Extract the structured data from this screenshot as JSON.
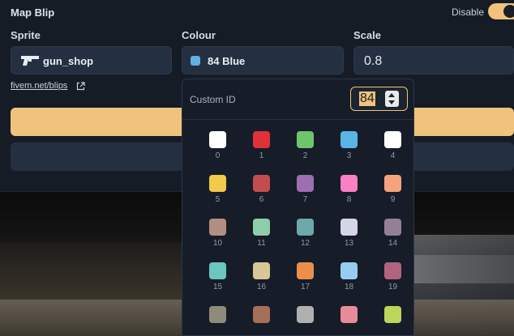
{
  "header": {
    "title": "Map Blip",
    "disable_label": "Disable",
    "disable_on": true
  },
  "fields": {
    "sprite": {
      "label": "Sprite",
      "value": "gun_shop",
      "icon": "pistol-icon"
    },
    "colour": {
      "label": "Colour",
      "value": "84 Blue",
      "swatch": "#5fb2e4"
    },
    "scale": {
      "label": "Scale",
      "value": "0.8"
    }
  },
  "link": {
    "text": "fivem.net/blips",
    "icon": "external-link-icon"
  },
  "dropdown": {
    "custom_id_label": "Custom ID",
    "custom_id_value": "84",
    "colors": [
      {
        "id": "0",
        "hex": "#ffffff"
      },
      {
        "id": "1",
        "hex": "#e0313a"
      },
      {
        "id": "2",
        "hex": "#6dc56e"
      },
      {
        "id": "3",
        "hex": "#5ab4e5"
      },
      {
        "id": "4",
        "hex": "#ffffff"
      },
      {
        "id": "5",
        "hex": "#f2c94c"
      },
      {
        "id": "6",
        "hex": "#c24d4f"
      },
      {
        "id": "7",
        "hex": "#9d6eb2"
      },
      {
        "id": "8",
        "hex": "#fb7fc3"
      },
      {
        "id": "9",
        "hex": "#f5a37c"
      },
      {
        "id": "10",
        "hex": "#b18f82"
      },
      {
        "id": "11",
        "hex": "#8fceaa"
      },
      {
        "id": "12",
        "hex": "#6ea8ad"
      },
      {
        "id": "13",
        "hex": "#d5d4e8"
      },
      {
        "id": "14",
        "hex": "#938097"
      },
      {
        "id": "15",
        "hex": "#69c6c1"
      },
      {
        "id": "16",
        "hex": "#d9c698"
      },
      {
        "id": "17",
        "hex": "#ea8f4d"
      },
      {
        "id": "18",
        "hex": "#96cdef"
      },
      {
        "id": "19",
        "hex": "#b2637f"
      },
      {
        "id": "",
        "hex": "#8f8b7a"
      },
      {
        "id": "",
        "hex": "#a66f59"
      },
      {
        "id": "",
        "hex": "#b0b0ae"
      },
      {
        "id": "",
        "hex": "#e88a9a"
      },
      {
        "id": "",
        "hex": "#bbd658"
      }
    ]
  }
}
